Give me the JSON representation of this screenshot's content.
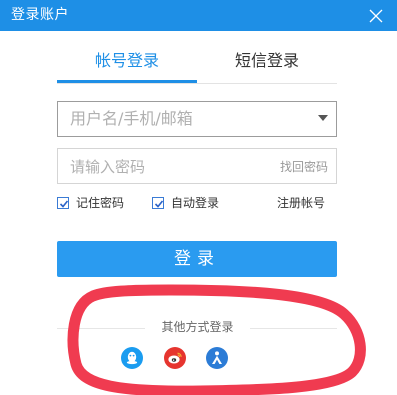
{
  "window": {
    "title": "登录账户"
  },
  "tabs": [
    {
      "label": "帐号登录",
      "active": true
    },
    {
      "label": "短信登录",
      "active": false
    }
  ],
  "username": {
    "placeholder": "用户名/手机/邮箱",
    "value": ""
  },
  "password": {
    "placeholder": "请输入密码",
    "value": "",
    "forgot_label": "找回密码"
  },
  "options": {
    "remember_label": "记住密码",
    "remember_checked": true,
    "auto_login_label": "自动登录",
    "auto_login_checked": true,
    "register_label": "注册帐号"
  },
  "login_button": {
    "label": "登录"
  },
  "other_login": {
    "label": "其他方式登录",
    "icons": [
      "qq-icon",
      "weibo-icon",
      "person-icon"
    ]
  },
  "colors": {
    "titlebar": "#1e8fe6",
    "accent": "#1e8fe6",
    "button": "#2a9bf0",
    "annotation": "#f03b50"
  }
}
